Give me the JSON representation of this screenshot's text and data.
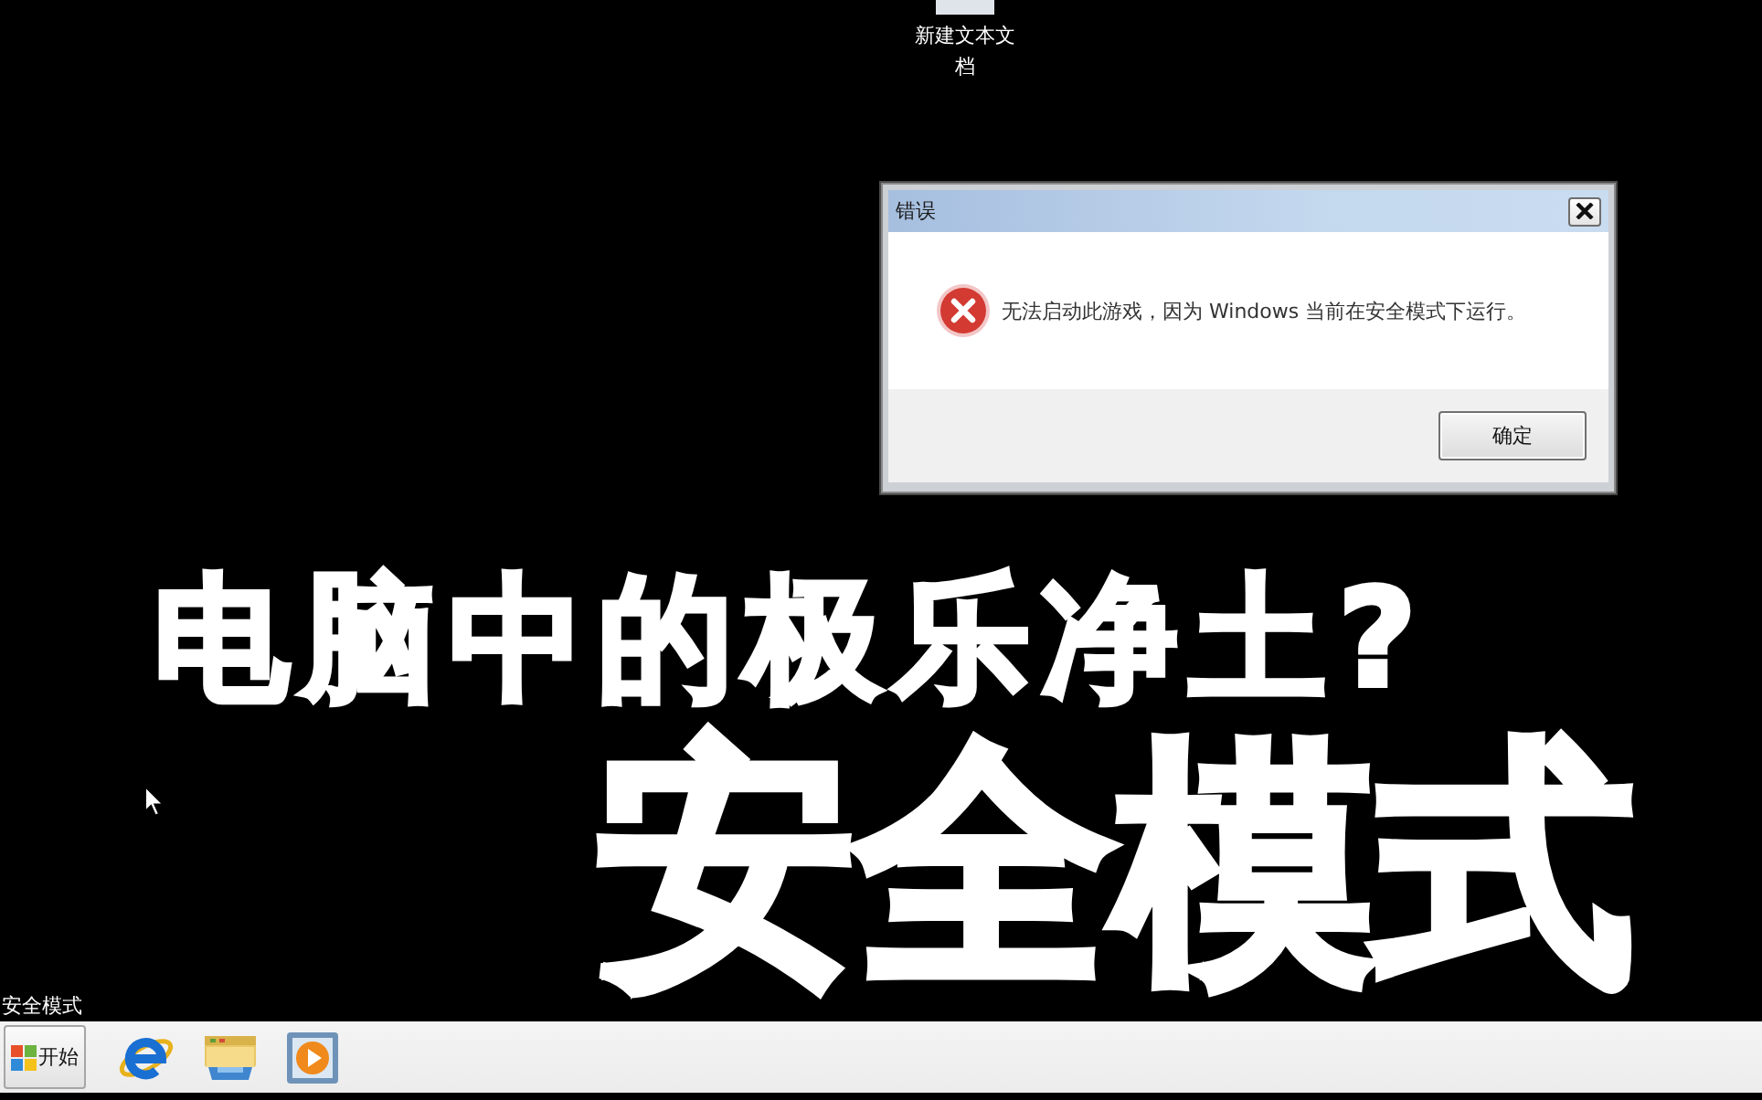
{
  "desktop": {
    "icons": [
      {
        "label": "新建文本文档"
      }
    ],
    "safe_mode_label": "安全模式"
  },
  "dialog": {
    "title": "错误",
    "message": "无法启动此游戏，因为 Windows 当前在安全模式下运行。",
    "buttons": [
      "确定"
    ]
  },
  "overlay_captions": [
    "电脑中的极乐净土?",
    "安全模式"
  ],
  "taskbar": {
    "start_button": "开始"
  }
}
